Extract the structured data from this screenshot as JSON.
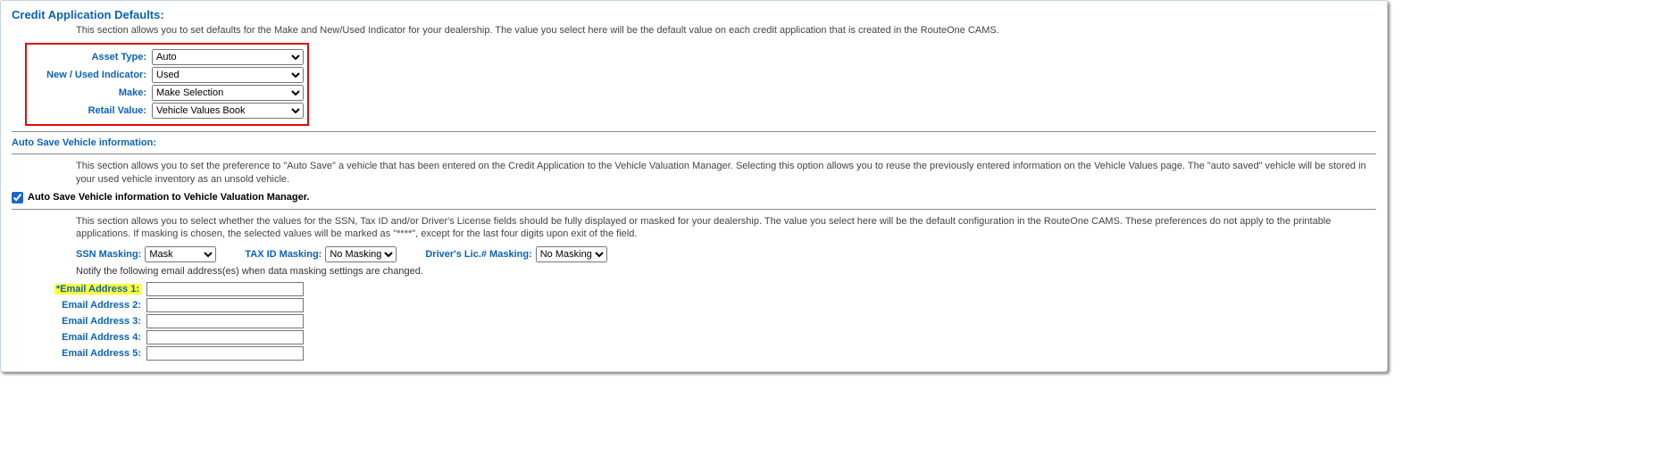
{
  "header": {
    "title": "Credit Application Defaults:",
    "desc": "This section allows you to set defaults for the Make and New/Used Indicator for your dealership. The value you select here will be the default value on each credit application that is created in the RouteOne CAMS."
  },
  "defaults": {
    "asset_type": {
      "label": "Asset Type:",
      "value": "Auto"
    },
    "new_used": {
      "label": "New / Used Indicator:",
      "value": "Used"
    },
    "make": {
      "label": "Make:",
      "value": "Make Selection"
    },
    "retail_value": {
      "label": "Retail Value:",
      "value": "Vehicle Values Book"
    }
  },
  "autosave": {
    "title": "Auto Save Vehicle information:",
    "desc": "This section allows you to set the preference to \"Auto Save\" a vehicle that has been entered on the Credit Application to the Vehicle Valuation Manager. Selecting this option allows you to reuse the previously entered information on the Vehicle Values page. The \"auto saved\" vehicle will be stored in your used vehicle inventory as an unsold vehicle.",
    "checkbox_label": "Auto Save Vehicle information to Vehicle Valuation Manager.",
    "checked": true
  },
  "masking": {
    "desc": "This section allows you to select whether the values for the SSN, Tax ID and/or Driver's License fields should be fully displayed or masked for your dealership. The value you select here will be the default configuration in the RouteOne CAMS. These preferences do not apply to the printable applications. If masking is chosen, the selected values will be marked as \"****\", except for the last four digits upon exit of the field.",
    "ssn": {
      "label": "SSN Masking:",
      "value": "Mask"
    },
    "tax": {
      "label": "TAX ID Masking:",
      "value": "No Masking"
    },
    "dl": {
      "label": "Driver's Lic.# Masking:",
      "value": "No Masking"
    },
    "notify": "Notify the following email address(es) when data masking settings are changed."
  },
  "emails": {
    "e1": {
      "label": "*Email Address 1:",
      "value": ""
    },
    "e2": {
      "label": "Email Address 2:",
      "value": ""
    },
    "e3": {
      "label": "Email Address 3:",
      "value": ""
    },
    "e4": {
      "label": "Email Address 4:",
      "value": ""
    },
    "e5": {
      "label": "Email Address 5:",
      "value": ""
    }
  }
}
